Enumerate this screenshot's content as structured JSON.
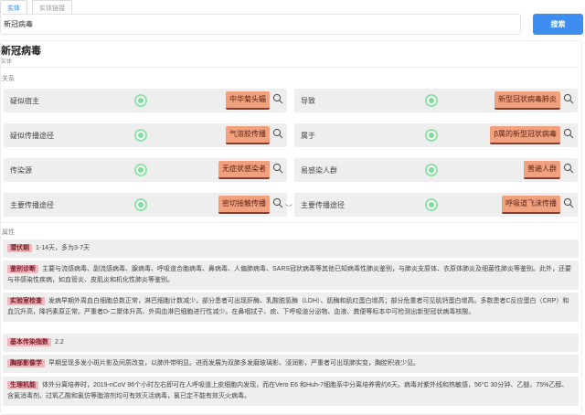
{
  "tabs": [
    {
      "label": "实体"
    },
    {
      "label": "实体链接"
    }
  ],
  "search": {
    "value": "新冠病毒",
    "button": "搜索"
  },
  "entity": {
    "name": "新冠病毒",
    "type": "实体"
  },
  "relations_label": "关系",
  "relations": [
    {
      "label": "疑似宿主",
      "value": "中华菊头蝠"
    },
    {
      "label": "导致",
      "value": "新型冠状病毒肺炎"
    },
    {
      "label": "疑似传播途径",
      "value": "气溶胶传播"
    },
    {
      "label": "属于",
      "value": "β属的新型冠状病毒"
    },
    {
      "label": "传染源",
      "value": "无症状感染者"
    },
    {
      "label": "易感染人群",
      "value": "普遍人群"
    },
    {
      "label": "主要传播途径",
      "value": "密切接触传播"
    },
    {
      "label": "主要传播途径",
      "value": "呼吸道飞沫传播"
    }
  ],
  "attributes_label": "属性",
  "attributes": [
    {
      "key": "潜伏期",
      "value": "1-14天，多为3-7天"
    },
    {
      "key": "鉴别诊断",
      "value": "主要与流感病毒、副流感病毒、腺病毒、呼吸道合胞病毒、鼻病毒、人偏肺病毒、SARS冠状病毒等其他已知病毒性肺炎鉴别，与肺炎支原体、衣原体肺炎及细菌性肺炎等鉴别。此外，还要与非感染性疾病，如血管炎、皮肌炎和机化性肺炎等鉴别。"
    },
    {
      "key": "实验室检查",
      "value": "发病早期外周血白细胞总数正常，淋巴细胞计数减少，部分患者可出现肝酶、乳酸脱氢酶（LDH）、肌酶和肌红蛋白增高；部分危重者可见肌钙蛋白增高。多数患者C反应蛋白（CRP）和血沉升高，降钙素原正常。严重者D-二聚体升高、外周血淋巴细胞进行性减少。在鼻咽拭子、痰、下呼吸道分泌物、血液、粪便等标本中可检测出新型冠状病毒核酸。"
    },
    {
      "key": "基本传染指数",
      "value": "2.2"
    },
    {
      "key": "胸部影像学",
      "value": "早期呈现多发小斑片影及间质改变，以肺外带明显。进而发展为双肺多发磨玻璃影、浸润影，严重者可出现肺实变，胸腔积液少见。"
    },
    {
      "key": "生理机能",
      "value": "体外分离培养时，2019-nCoV 96个小时左右即可在人呼吸道上皮细胞内发现，而在Vero E6 和Huh-7细胞系中分离培养需约6天。病毒对紫外线和热敏感，56°C 30分钟、乙醚、75%乙醇、含氯消毒剂、过氧乙酸和氯仿等脂溶剂均可有效灭活病毒，氯已定不能有效灭火病毒。"
    }
  ]
}
